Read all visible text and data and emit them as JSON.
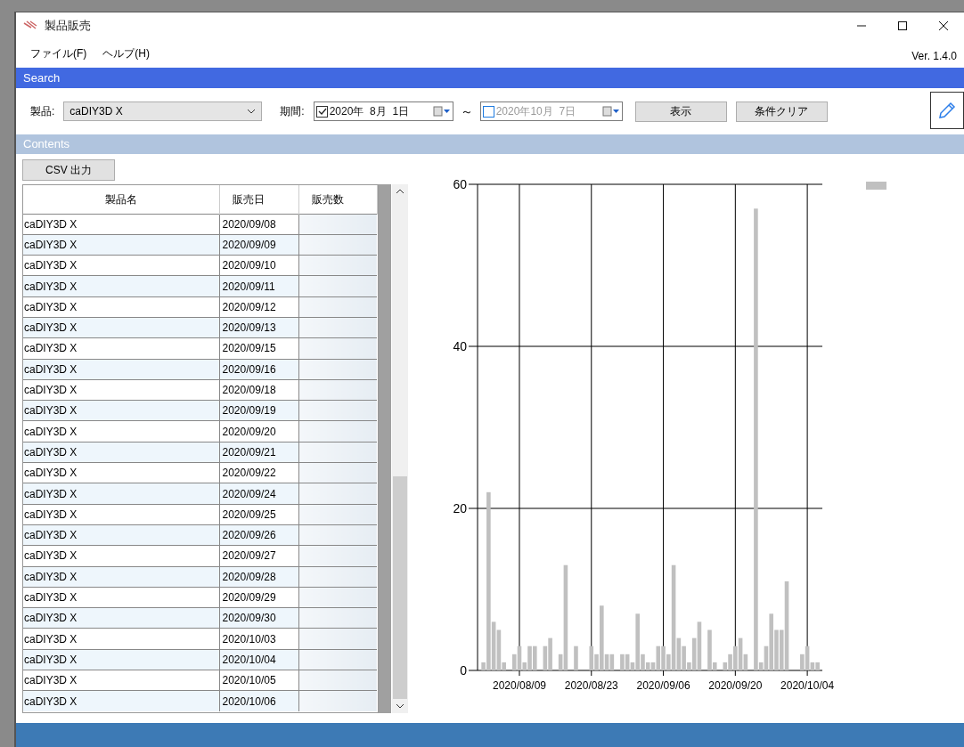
{
  "window": {
    "title": "製品販売"
  },
  "menu": [
    "ファイル(F)",
    "ヘルプ(H)"
  ],
  "version": "Ver. 1.4.0",
  "search": {
    "title": "Search",
    "product_label": "製品:",
    "product": "caDIY3D X",
    "period_label": "期間:",
    "from": {
      "checked": true,
      "value": "2020年  8月  1日"
    },
    "separator": "～",
    "to": {
      "checked": false,
      "value": "2020年10月  7日"
    },
    "buttons": [
      "表示",
      "条件クリア"
    ]
  },
  "contents": {
    "title": "Contents",
    "csv_button": "CSV 出力",
    "table": {
      "columns": [
        "製品名",
        "販売日",
        "販売数"
      ],
      "rows": [
        {
          "product": "caDIY3D X",
          "date": "2020/09/08"
        },
        {
          "product": "caDIY3D X",
          "date": "2020/09/09"
        },
        {
          "product": "caDIY3D X",
          "date": "2020/09/10"
        },
        {
          "product": "caDIY3D X",
          "date": "2020/09/11"
        },
        {
          "product": "caDIY3D X",
          "date": "2020/09/12"
        },
        {
          "product": "caDIY3D X",
          "date": "2020/09/13"
        },
        {
          "product": "caDIY3D X",
          "date": "2020/09/15"
        },
        {
          "product": "caDIY3D X",
          "date": "2020/09/16"
        },
        {
          "product": "caDIY3D X",
          "date": "2020/09/18"
        },
        {
          "product": "caDIY3D X",
          "date": "2020/09/19"
        },
        {
          "product": "caDIY3D X",
          "date": "2020/09/20"
        },
        {
          "product": "caDIY3D X",
          "date": "2020/09/21"
        },
        {
          "product": "caDIY3D X",
          "date": "2020/09/22"
        },
        {
          "product": "caDIY3D X",
          "date": "2020/09/24"
        },
        {
          "product": "caDIY3D X",
          "date": "2020/09/25"
        },
        {
          "product": "caDIY3D X",
          "date": "2020/09/26"
        },
        {
          "product": "caDIY3D X",
          "date": "2020/09/27"
        },
        {
          "product": "caDIY3D X",
          "date": "2020/09/28"
        },
        {
          "product": "caDIY3D X",
          "date": "2020/09/29"
        },
        {
          "product": "caDIY3D X",
          "date": "2020/09/30"
        },
        {
          "product": "caDIY3D X",
          "date": "2020/10/03"
        },
        {
          "product": "caDIY3D X",
          "date": "2020/10/04"
        },
        {
          "product": "caDIY3D X",
          "date": "2020/10/05"
        },
        {
          "product": "caDIY3D X",
          "date": "2020/10/06"
        }
      ]
    },
    "chart_data": {
      "type": "bar",
      "ylim": [
        0,
        60
      ],
      "yticks": [
        0,
        20,
        40,
        60
      ],
      "grid": true,
      "categories": [
        null,
        null,
        null,
        null,
        null,
        null,
        null,
        "2020/08/09",
        null,
        null,
        null,
        null,
        null,
        null,
        null,
        null,
        null,
        null,
        null,
        null,
        null,
        "2020/08/23",
        null,
        null,
        null,
        null,
        null,
        null,
        null,
        null,
        null,
        null,
        null,
        null,
        null,
        "2020/09/06",
        null,
        null,
        null,
        null,
        null,
        null,
        null,
        null,
        null,
        null,
        null,
        null,
        null,
        "2020/09/20",
        null,
        null,
        null,
        null,
        null,
        null,
        null,
        null,
        null,
        null,
        null,
        null,
        null,
        "2020/10/04",
        null,
        null
      ],
      "series": [
        {
          "color": "#c0c0c0",
          "values": [
            1,
            22,
            6,
            5,
            1,
            null,
            2,
            3,
            1,
            3,
            3,
            null,
            3,
            4,
            null,
            2,
            13,
            null,
            3,
            null,
            null,
            3,
            2,
            8,
            2,
            2,
            null,
            2,
            2,
            1,
            7,
            2,
            1,
            1,
            3,
            3,
            2,
            13,
            4,
            3,
            1,
            4,
            6,
            null,
            5,
            1,
            null,
            1,
            2,
            3,
            4,
            2,
            null,
            57,
            1,
            3,
            7,
            5,
            5,
            11,
            null,
            null,
            2,
            3,
            1,
            1
          ]
        }
      ]
    }
  }
}
